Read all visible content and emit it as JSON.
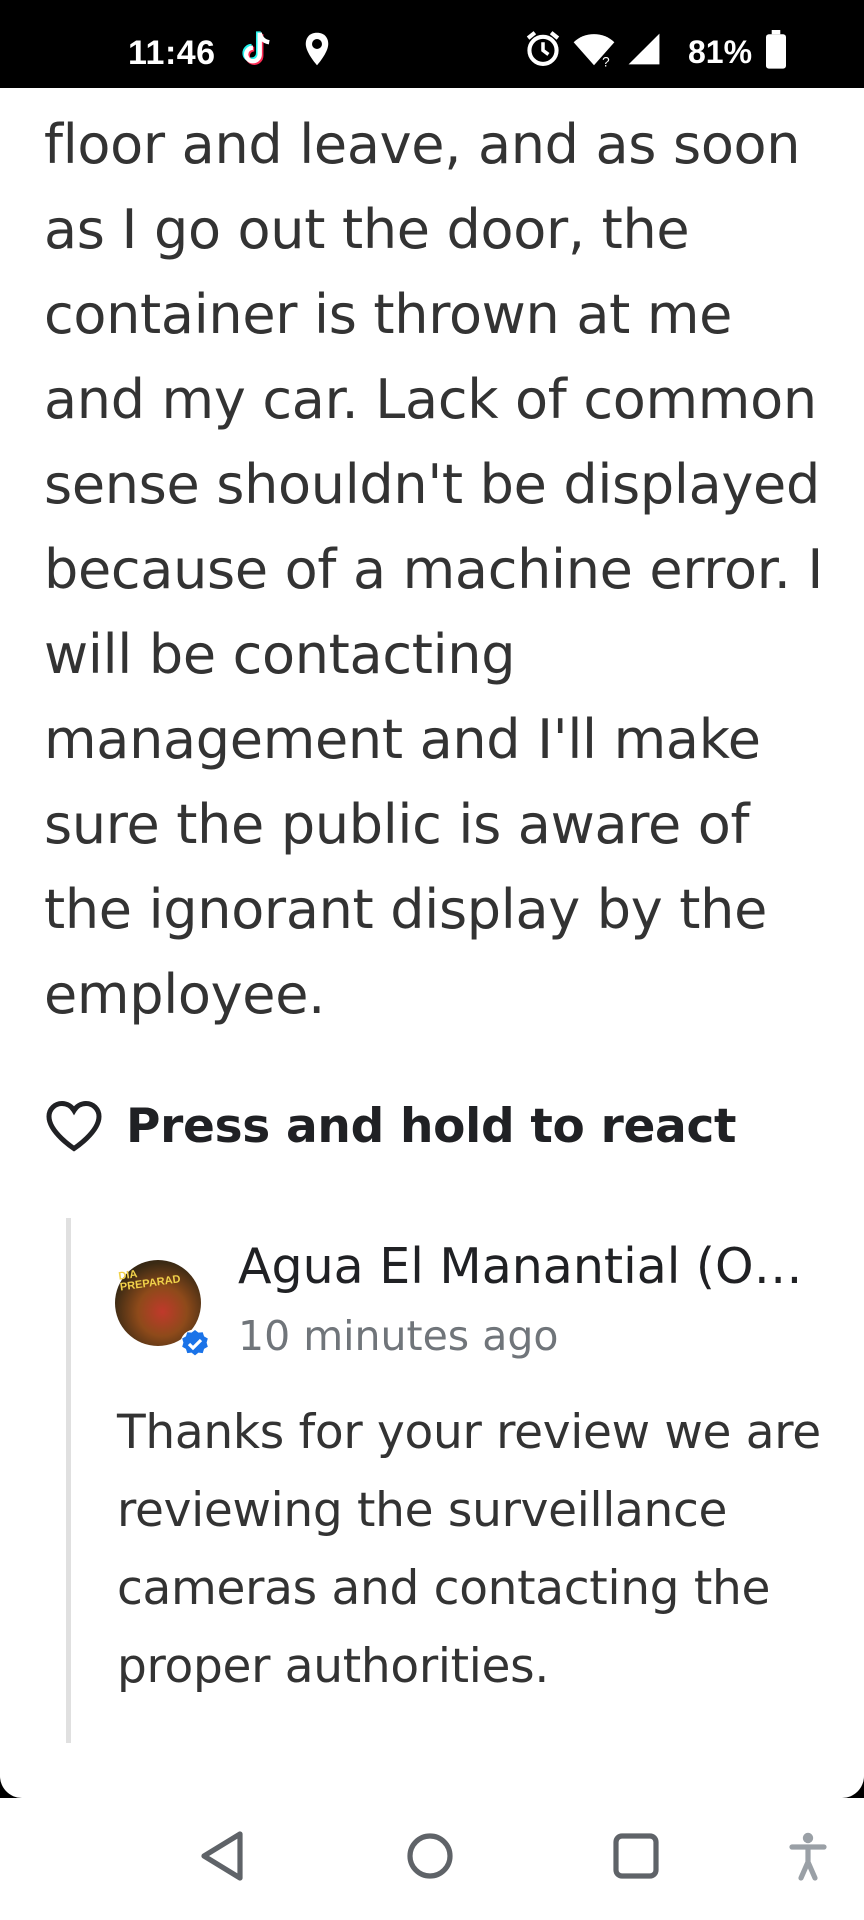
{
  "status_bar": {
    "time": "11:46",
    "battery_percent": "81%",
    "icons": [
      "tiktok-icon",
      "location-icon",
      "alarm-icon",
      "wifi-icon",
      "signal-icon",
      "battery-icon"
    ]
  },
  "review": {
    "text": "floor and leave, and as soon as I go out the door, the container is thrown at me and my car. Lack of common sense shouldn't be displayed because of a machine error. I will be contacting management and I'll make sure the public is aware of the ignorant display by the employee."
  },
  "reaction": {
    "icon": "heart-outline-icon",
    "label": "Press and hold to react"
  },
  "owner_reply": {
    "name": "Agua El Manantial (Owner)",
    "timestamp": "10 minutes ago",
    "text": "Thanks for your review we are reviewing the surveillance cameras and contacting the proper authorities.",
    "avatar_text": "DIA PREPARAD",
    "verified_color": "#1a73e8"
  },
  "nav_bar": {
    "buttons": [
      "back-icon",
      "home-icon",
      "recents-icon",
      "accessibility-icon"
    ]
  }
}
